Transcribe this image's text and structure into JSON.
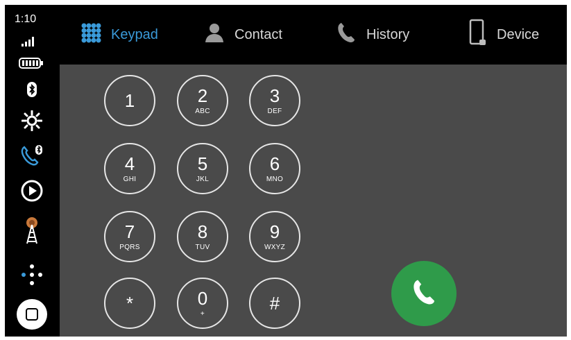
{
  "status": {
    "time": "1:10"
  },
  "tabs": [
    {
      "label": "Keypad",
      "icon": "keypad-grid-icon",
      "active": true
    },
    {
      "label": "Contact",
      "icon": "person-icon",
      "active": false
    },
    {
      "label": "History",
      "icon": "phone-handset-icon",
      "active": false
    },
    {
      "label": "Device",
      "icon": "smartphone-icon",
      "active": false
    }
  ],
  "keypad": {
    "keys": [
      {
        "digit": "1",
        "letters": ""
      },
      {
        "digit": "2",
        "letters": "ABC"
      },
      {
        "digit": "3",
        "letters": "DEF"
      },
      {
        "digit": "4",
        "letters": "GHI"
      },
      {
        "digit": "5",
        "letters": "JKL"
      },
      {
        "digit": "6",
        "letters": "MNO"
      },
      {
        "digit": "7",
        "letters": "PQRS"
      },
      {
        "digit": "8",
        "letters": "TUV"
      },
      {
        "digit": "9",
        "letters": "WXYZ"
      },
      {
        "digit": "*",
        "letters": ""
      },
      {
        "digit": "0",
        "letters": "+"
      },
      {
        "digit": "#",
        "letters": ""
      }
    ]
  },
  "colors": {
    "accent": "#3a9ad9",
    "call_button": "#2f9b4a",
    "content_bg": "#4a4a4a",
    "bar_bg": "#000000"
  },
  "sidebar_icons": [
    "bluetooth-icon",
    "brightness-icon",
    "phone-bluetooth-icon",
    "play-icon",
    "radio-tower-icon",
    "apps-dots-icon",
    "home-button-icon"
  ]
}
